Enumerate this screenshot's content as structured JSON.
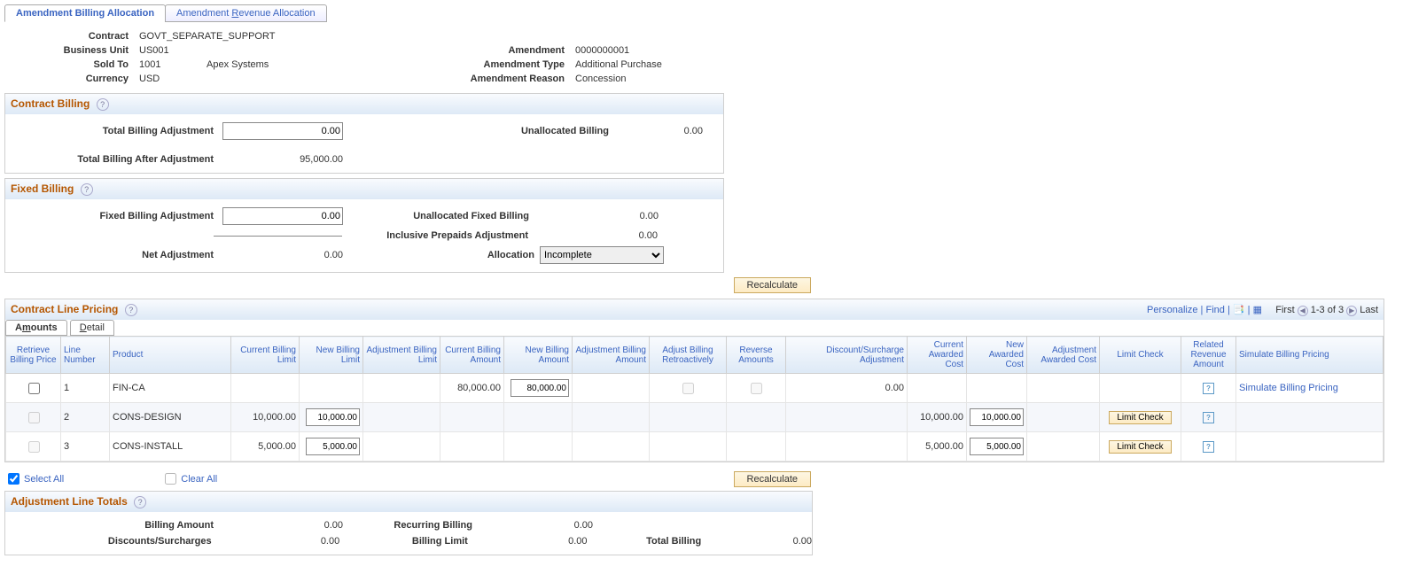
{
  "tabs": {
    "active": "Amendment Billing Allocation",
    "inactive_pre": "Amendment ",
    "inactive_u": "R",
    "inactive_post": "evenue Allocation"
  },
  "header": {
    "contract_lab": "Contract",
    "contract": "GOVT_SEPARATE_SUPPORT",
    "bu_lab": "Business Unit",
    "bu": "US001",
    "sold_lab": "Sold To",
    "sold": "1001",
    "sold_name": "Apex Systems",
    "curr_lab": "Currency",
    "curr": "USD",
    "amd_lab": "Amendment",
    "amd": "0000000001",
    "amdtype_lab": "Amendment Type",
    "amdtype": "Additional Purchase",
    "amdreason_lab": "Amendment Reason",
    "amdreason": "Concession"
  },
  "cb": {
    "title": "Contract Billing",
    "tba_lab": "Total Billing Adjustment",
    "tba": "0.00",
    "tbaa_lab": "Total Billing After Adjustment",
    "tbaa": "95,000.00",
    "ub_lab": "Unallocated Billing",
    "ub": "0.00"
  },
  "fb": {
    "title": "Fixed Billing",
    "fba_lab": "Fixed Billing Adjustment",
    "fba": "0.00",
    "na_lab": "Net Adjustment",
    "na": "0.00",
    "ufb_lab": "Unallocated Fixed Billing",
    "ufb": "0.00",
    "ipa_lab": "Inclusive Prepaids Adjustment",
    "ipa": "0.00",
    "alloc_lab": "Allocation",
    "alloc": "Incomplete"
  },
  "recalc": "Recalculate",
  "clp": {
    "title": "Contract Line Pricing",
    "personalize": "Personalize",
    "find": "Find",
    "range": "1-3 of 3",
    "first": "First",
    "last": "Last",
    "amounts_pre": "A",
    "amounts_u": "m",
    "amounts_post": "ounts",
    "detail_pre": "",
    "detail_u": "D",
    "detail_post": "etail",
    "cols": {
      "c1": "Retrieve Billing Price",
      "c2": "Line Number",
      "c3": "Product",
      "c4": "Current Billing Limit",
      "c5": "New Billing Limit",
      "c6": "Adjustment Billing Limit",
      "c7": "Current Billing Amount",
      "c8": "New Billing Amount",
      "c9": "Adjustment Billing Amount",
      "c10": "Adjust Billing Retroactively",
      "c11": "Reverse Amounts",
      "c12": "Discount/Surcharge Adjustment",
      "c13": "Current Awarded Cost",
      "c14": "New Awarded Cost",
      "c15": "Adjustment Awarded Cost",
      "c16": "Limit Check",
      "c17": "Related Revenue Amount",
      "c18": "Simulate Billing Pricing"
    },
    "rows": [
      {
        "line": "1",
        "product": "FIN-CA",
        "cbl": "",
        "nbl": "",
        "abl": "",
        "cba": "80,000.00",
        "nba": "80,000.00",
        "aba": "",
        "adj_retro": true,
        "rev": true,
        "dsa": "0.00",
        "cac": "",
        "nac": "",
        "aac": "",
        "limit": false,
        "related": true,
        "sim": "Simulate Billing Pricing"
      },
      {
        "line": "2",
        "product": "CONS-DESIGN",
        "cbl": "10,000.00",
        "nbl": "10,000.00",
        "abl": "",
        "cba": "",
        "nba": "",
        "aba": "",
        "adj_retro": false,
        "rev": false,
        "dsa": "",
        "cac": "10,000.00",
        "nac": "10,000.00",
        "aac": "",
        "limit": true,
        "related": true,
        "sim": ""
      },
      {
        "line": "3",
        "product": "CONS-INSTALL",
        "cbl": "5,000.00",
        "nbl": "5,000.00",
        "abl": "",
        "cba": "",
        "nba": "",
        "aba": "",
        "adj_retro": false,
        "rev": false,
        "dsa": "",
        "cac": "5,000.00",
        "nac": "5,000.00",
        "aac": "",
        "limit": true,
        "related": true,
        "sim": ""
      }
    ],
    "limit_btn": "Limit Check",
    "select_all": "Select All",
    "clear_all": "Clear All"
  },
  "alt": {
    "title": "Adjustment Line Totals",
    "ba_lab": "Billing Amount",
    "ba": "0.00",
    "ds_lab": "Discounts/Surcharges",
    "ds": "0.00",
    "rb_lab": "Recurring Billing",
    "rb": "0.00",
    "bl_lab": "Billing Limit",
    "bl": "0.00",
    "tb_lab": "Total Billing",
    "tb": "0.00"
  }
}
